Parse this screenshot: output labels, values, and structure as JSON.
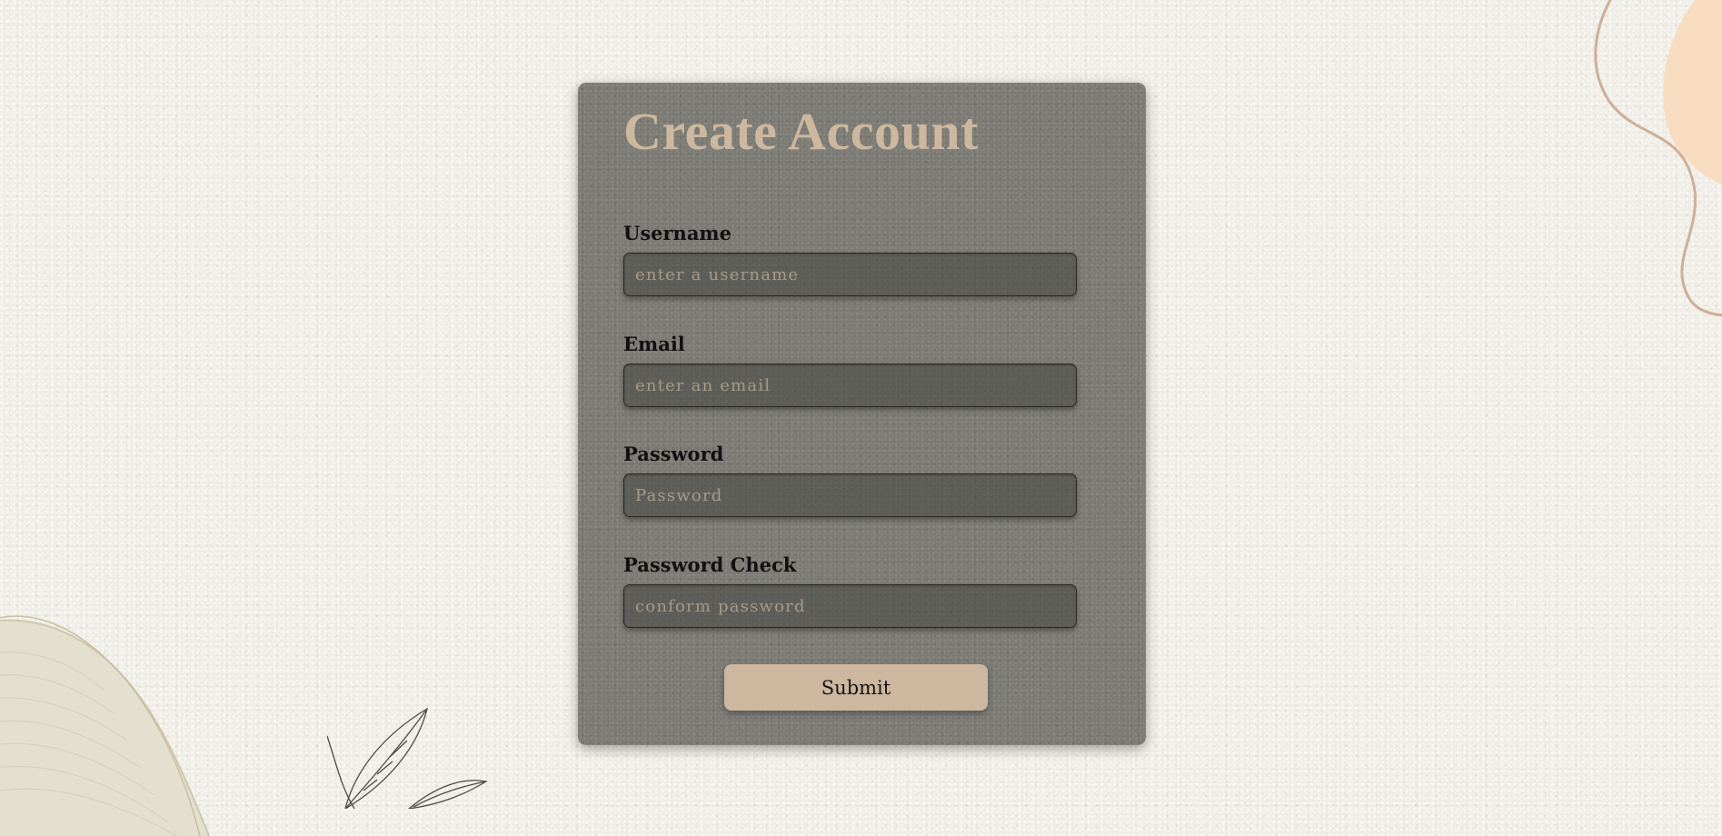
{
  "form": {
    "title": "Create Account",
    "fields": [
      {
        "label": "Username",
        "placeholder": "enter a username",
        "value": ""
      },
      {
        "label": "Email",
        "placeholder": "enter an email",
        "value": ""
      },
      {
        "label": "Password",
        "placeholder": "Password",
        "value": ""
      },
      {
        "label": "Password Check",
        "placeholder": "conform password",
        "value": ""
      }
    ],
    "submit_label": "Submit"
  },
  "colors": {
    "background": "#efede6",
    "card": "#7b7a74",
    "accent": "#cdb79e",
    "label_text": "#111111",
    "placeholder_text": "#a89a86"
  },
  "icons": [
    "fabric-decoration",
    "leaf-decoration",
    "blob-decoration"
  ]
}
